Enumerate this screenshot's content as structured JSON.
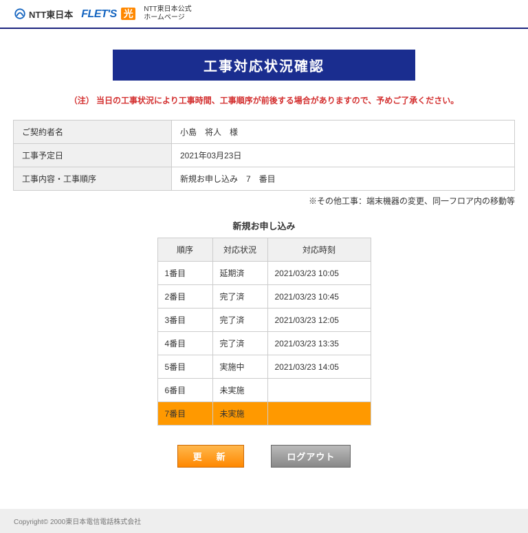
{
  "header": {
    "ntt_logo_text": "NTT東日本",
    "flets_text": "FLET'S",
    "hikari_text": "光",
    "sub_text_line1": "NTT東日本公式",
    "sub_text_line2": "ホームページ"
  },
  "page_title": "工事対応状況確認",
  "notice": "（注） 当日の工事状況により工事時間、工事順序が前後する場合がありますので、予めご了承ください。",
  "info": {
    "labels": {
      "customer": "ご契約者名",
      "date": "工事予定日",
      "content": "工事内容・工事順序"
    },
    "values": {
      "customer": "小島　将人　様",
      "date": "2021年03月23日",
      "content": "新規お申し込み　7　番目"
    }
  },
  "sub_note": "※その他工事：端末機器の変更、同一フロア内の移動等",
  "section_title": "新規お申し込み",
  "status_table": {
    "headers": {
      "order": "順序",
      "status": "対応状況",
      "time": "対応時刻"
    },
    "rows": [
      {
        "order": "1番目",
        "status": "延期済",
        "time": "2021/03/23 10:05",
        "highlight": false
      },
      {
        "order": "2番目",
        "status": "完了済",
        "time": "2021/03/23 10:45",
        "highlight": false
      },
      {
        "order": "3番目",
        "status": "完了済",
        "time": "2021/03/23 12:05",
        "highlight": false
      },
      {
        "order": "4番目",
        "status": "完了済",
        "time": "2021/03/23 13:35",
        "highlight": false
      },
      {
        "order": "5番目",
        "status": "実施中",
        "time": "2021/03/23 14:05",
        "highlight": false
      },
      {
        "order": "6番目",
        "status": "未実施",
        "time": "",
        "highlight": false
      },
      {
        "order": "7番目",
        "status": "未実施",
        "time": "",
        "highlight": true
      }
    ]
  },
  "buttons": {
    "refresh": "更　新",
    "logout": "ログアウト"
  },
  "footer": "Copyright© 2000東日本電信電話株式会社"
}
